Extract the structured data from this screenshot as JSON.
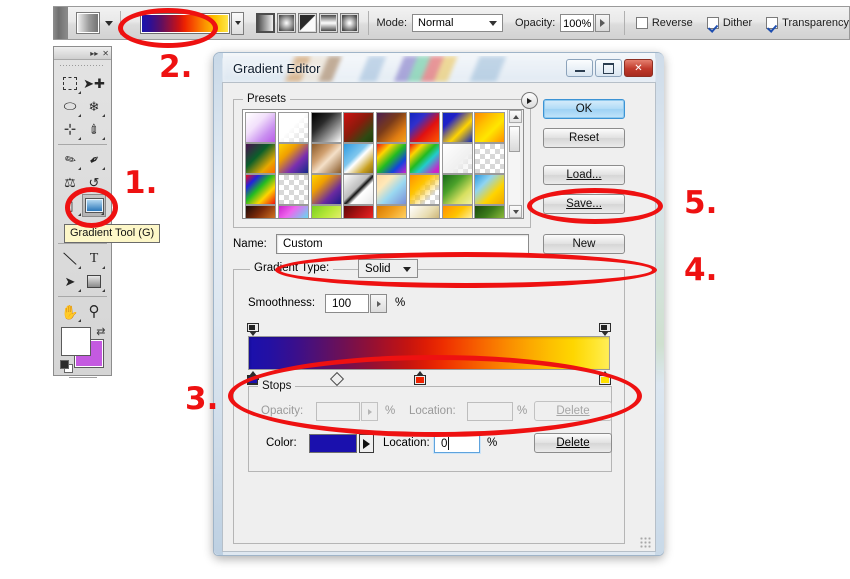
{
  "options_bar": {
    "tool_preset_name": "tool-preset-picker",
    "gradient_preset_name": "gradient-picker",
    "gradient_types": [
      {
        "name": "linear-gradient",
        "selected": true
      },
      {
        "name": "radial-gradient",
        "selected": false
      },
      {
        "name": "angle-gradient",
        "selected": false
      },
      {
        "name": "reflected-gradient",
        "selected": false
      },
      {
        "name": "diamond-gradient",
        "selected": false
      }
    ],
    "mode_label": "Mode:",
    "mode_value": "Normal",
    "opacity_label": "Opacity:",
    "opacity_value": "100%",
    "checkboxes": [
      {
        "label": "Reverse",
        "checked": false
      },
      {
        "label": "Dither",
        "checked": true
      },
      {
        "label": "Transparency",
        "checked": true
      }
    ]
  },
  "toolbox": {
    "collapse_glyph": "▸▸",
    "close_glyph": "✕",
    "tools": [
      {
        "name": "marquee-tool",
        "glyph": "⬚"
      },
      {
        "name": "move-tool",
        "glyph": "➤"
      },
      {
        "name": "lasso-tool",
        "glyph": "⬭"
      },
      {
        "name": "magic-wand-tool",
        "glyph": "✴"
      },
      {
        "name": "crop-tool",
        "glyph": "⊹"
      },
      {
        "name": "eyedropper-tool",
        "glyph": "✐"
      },
      {
        "name": "healing-brush-tool",
        "glyph": "✒"
      },
      {
        "name": "brush-tool",
        "glyph": "✎"
      },
      {
        "name": "clone-stamp-tool",
        "glyph": "⚓"
      },
      {
        "name": "history-brush-tool",
        "glyph": "↺"
      },
      {
        "name": "eraser-tool",
        "glyph": "◭"
      },
      {
        "name": "gradient-tool",
        "glyph": ""
      },
      {
        "name": "blur-tool",
        "glyph": "◡"
      },
      {
        "name": "dodge-tool",
        "glyph": "⚲"
      },
      {
        "name": "pen-tool",
        "glyph": "✒"
      },
      {
        "name": "type-tool",
        "glyph": "T"
      },
      {
        "name": "path-selection-tool",
        "glyph": "➤"
      },
      {
        "name": "rectangle-tool",
        "glyph": "■"
      },
      {
        "name": "hand-tool",
        "glyph": "✋"
      },
      {
        "name": "zoom-tool",
        "glyph": "⌕"
      }
    ],
    "foreground_color": "#ffffff",
    "background_color": "#c45ae0",
    "swap_glyph": "⇄"
  },
  "tooltip": {
    "text": "Gradient Tool (G)"
  },
  "dialog": {
    "title": "Gradient Editor",
    "window_buttons": {
      "minimize": "minimize-button",
      "maximize": "maximize-button",
      "close_glyph": "✕"
    },
    "presets": {
      "title": "Presets",
      "menu_button": "presets-menu-button",
      "swatches": [
        "linear-gradient(135deg,#ffffff 0%,#f2e0fb 38%,#c98ff0 72%,#b95ce8 100%)",
        "linear-gradient(135deg,#ffffff 0%,#ffffff 45%,rgba(255,255,255,0) 100%),repeating-conic-gradient(#d8d8d8 0% 25%,#ffffff 0% 50%) 0 0/10px 10px",
        "linear-gradient(135deg,#000000 0%,#2a2a2a 35%,#9a9a9a 70%,#ffffff 100%)",
        "linear-gradient(135deg,#cc1111 0%,#8a1b0c 45%,#2d4a12 80%,#1f3d0c 100%)",
        "linear-gradient(135deg,#4b1f52 0%,#7a3b1a 40%,#e07d12 75%,#f6a31a 100%)",
        "linear-gradient(135deg,#1226c0 0%,#3030cc 28%,#e01111 60%,#ff5a00 100%)",
        "linear-gradient(135deg,#1226c0 0%,#2020c8 25%,#ffd400 62%,#1226c0 100%)",
        "linear-gradient(135deg,#ff8a00 0%,#ffc400 35%,#ffe600 60%,#ff9000 100%)",
        "linear-gradient(135deg,#4a1050 0%,#0b5f2a 40%,#e8a800 75%,#ff6a00 100%)",
        "linear-gradient(135deg,#ffd400 0%,#f0a000 30%,#7a2fb0 65%,#142a8a 100%)",
        "linear-gradient(135deg,#8a5a2a 0%,#d0a070 35%,#f4e0c8 55%,#8a5a2a 100%)",
        "linear-gradient(135deg,#2e9ae0 0%,#7fc7ee 40%,#ffffff 52%,#c8a020 80%,#8a6a10 100%)",
        "linear-gradient(135deg,#ee1111 0%,#ffd400 25%,#22bb22 50%,#1144dd 75%,#cc22cc 100%)",
        "linear-gradient(135deg,#ee1111 0%,#ffd400 22%,#22bb22 45%,#22cccc 62%,#cc22cc 90%)",
        "linear-gradient(135deg,#ffffff 0%,#f0f0f0 60%,rgba(255,255,255,0) 100%),repeating-conic-gradient(#d8d8d8 0% 25%,#ffffff 0% 50%) 0 0/10px 10px",
        "repeating-conic-gradient(#d8d8d8 0% 25%,#ffffff 0% 50%) 0 0/10px 10px",
        "linear-gradient(135deg,#ee1111 0%,#2222dd 22%,#22bb22 45%,#ffd400 70%,#ee1111 100%)",
        "repeating-conic-gradient(#d8d8d8 0% 25%,#ffffff 0% 50%) 0 0/10px 10px",
        "linear-gradient(135deg,#ffd400 0%,#f0a000 30%,#6a2aa0 68%,#1a1a8a 100%)",
        "linear-gradient(135deg,#ffffff 0%,#bdbdbd 44%,#111111 52%,#ffffff 62%,#e8e8e8 100%)",
        "linear-gradient(135deg,#ffd8a0 0%,#ffe8b8 28%,#9ad8f0 58%,#7a8fd8 100%)",
        "linear-gradient(135deg,#ff9000 0%,#ffc400 35%,rgba(255,255,255,0) 75%),repeating-conic-gradient(#d8d8d8 0% 25%,#ffffff 0% 50%) 0 0/10px 10px",
        "linear-gradient(135deg,#1a6a1a 0%,#4aa02a 35%,#d8e060 70%,#f0f0a0 100%)",
        "linear-gradient(135deg,#2e9ae0 0%,#8fd4f2 30%,#ffd400 65%,#f0a800 100%)",
        "linear-gradient(135deg,#1a0a0a 0%,#7a2a0a 35%,#d07020 70%,#f0a050 100%)",
        "linear-gradient(135deg,#cc22cc 0%,#ee66ee 30%,#66d8f0 70%,#ffffff 100%)",
        "linear-gradient(135deg,#7ad020 0%,#b8e83a 40%,#e8f070 75%,#f8f8a0 100%)",
        "linear-gradient(135deg,#5a0808 0%,#aa1111 35%,#e02020 65%,#f0c0a0 100%)",
        "linear-gradient(135deg,#d87800 0%,#f0a020 35%,#ffd060 70%,rgba(255,255,255,0) 100%),repeating-conic-gradient(#d8d8d8 0% 25%,#ffffff 0% 50%) 0 0/10px 10px",
        "linear-gradient(135deg,#ffffff 0%,#e8dcb0 45%,#c8b070 75%,#ffffff 100%)",
        "linear-gradient(135deg,#ff9000 0%,#ffc400 38%,#fff0a0 72%,rgba(255,255,255,0) 100%),repeating-conic-gradient(#d8d8d8 0% 25%,#ffffff 0% 50%) 0 0/10px 10px",
        "linear-gradient(135deg,#1a4a0a 0%,#3a7a1a 35%,#8ab83a 70%,#d0e870 100%)"
      ]
    },
    "buttons": {
      "ok": "OK",
      "reset": "Reset",
      "load": "Load...",
      "save": "Save...",
      "new": "New"
    },
    "name_row": {
      "label": "Name:",
      "value": "Custom"
    },
    "gradient_type": {
      "label": "Gradient Type:",
      "value": "Solid",
      "smoothness_label": "Smoothness:",
      "smoothness_value": "100",
      "percent": "%"
    },
    "gradient_bar": {
      "opacity_stops": [
        {
          "name": "opacity-stop-left",
          "location_pct": 0
        },
        {
          "name": "opacity-stop-right",
          "location_pct": 100
        }
      ],
      "color_stops": [
        {
          "name": "color-stop-blue",
          "location_pct": 0,
          "color": "#1a10ad",
          "selected": true
        },
        {
          "name": "color-stop-red",
          "location_pct": 47,
          "color": "#ee2200",
          "selected": false
        },
        {
          "name": "color-stop-yellow",
          "location_pct": 100,
          "color": "#ffe000",
          "selected": false
        }
      ],
      "midpoint_pct": 24
    },
    "stops": {
      "title": "Stops",
      "opacity_label": "Opacity:",
      "opacity_value": "",
      "opacity_percent": "%",
      "location_label_top": "Location:",
      "location_value_top": "",
      "location_percent_top": "%",
      "delete_top": "Delete",
      "color_label": "Color:",
      "color_value": "#1a10ad",
      "location_label_bottom": "Location:",
      "location_value_bottom": "0",
      "location_percent_bottom": "%",
      "delete_bottom": "Delete"
    }
  },
  "annotations": [
    {
      "id": "ann-1",
      "label": "1.",
      "target": "gradient-tool"
    },
    {
      "id": "ann-2",
      "label": "2.",
      "target": "gradient-picker"
    },
    {
      "id": "ann-3",
      "label": "3.",
      "target": "gradient-bar"
    },
    {
      "id": "ann-4",
      "label": "4.",
      "target": "name-and-new"
    },
    {
      "id": "ann-5",
      "label": "5.",
      "target": "save-button"
    }
  ]
}
